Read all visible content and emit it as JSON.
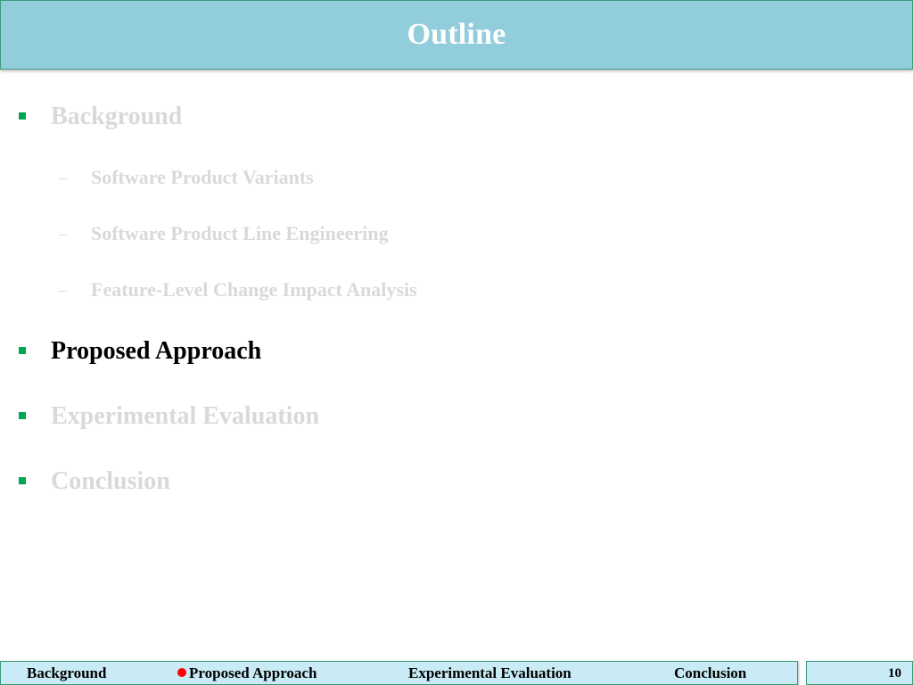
{
  "slide": {
    "title": "Outline",
    "outline": [
      {
        "label": "Background",
        "level": 1,
        "state": "dim"
      },
      {
        "label": "Software Product Variants",
        "level": 2,
        "state": "dim"
      },
      {
        "label": "Software Product Line Engineering",
        "level": 2,
        "state": "dim"
      },
      {
        "label": "Feature-Level Change Impact Analysis",
        "level": 2,
        "state": "dim"
      },
      {
        "label": "Proposed Approach",
        "level": 1,
        "state": "active"
      },
      {
        "label": "Experimental Evaluation",
        "level": 1,
        "state": "dim"
      },
      {
        "label": "Conclusion",
        "level": 1,
        "state": "dim"
      }
    ],
    "sub_marker": "–"
  },
  "footer": {
    "nav": [
      {
        "label": "Background",
        "current": false
      },
      {
        "label": "Proposed Approach",
        "current": true
      },
      {
        "label": "Experimental Evaluation",
        "current": false
      },
      {
        "label": "Conclusion",
        "current": false
      }
    ],
    "page_number": "10"
  },
  "colors": {
    "title_bar": "#92cddc",
    "title_text": "#ffffff",
    "footer_bar": "#c8ebf5",
    "border": "#3a9a7a",
    "bullet": "#00a651",
    "dim_text": "#d9d9d9",
    "active_text": "#000000",
    "current_marker": "#ff0000"
  }
}
